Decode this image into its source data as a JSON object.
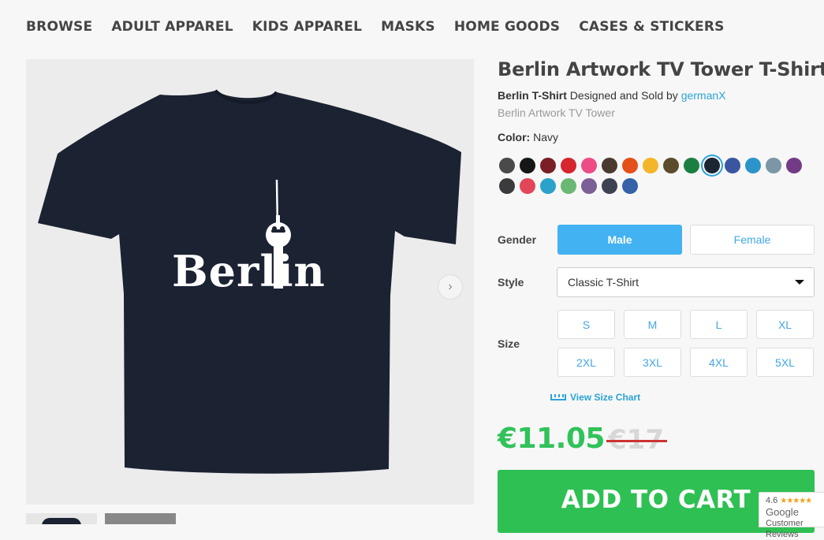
{
  "nav": [
    "BROWSE",
    "ADULT APPAREL",
    "KIDS APPAREL",
    "MASKS",
    "HOME GOODS",
    "CASES & STICKERS"
  ],
  "product": {
    "title": "Berlin Artwork TV Tower T-Shirt",
    "type_label": "Berlin T-Shirt",
    "designed_by_text": "Designed and Sold by",
    "designer": "germanX",
    "description": "Berlin Artwork TV Tower",
    "artwork_text": "Berlin"
  },
  "color": {
    "label": "Color:",
    "value": "Navy",
    "swatches": [
      "#4a4a4a",
      "#161616",
      "#7a1f24",
      "#d6262e",
      "#ee4c87",
      "#4b3a30",
      "#e4501a",
      "#f5b52a",
      "#5b4d2c",
      "#1c7f42",
      "#1d2533",
      "#3b56a0",
      "#2b94cb",
      "#7b96a4",
      "#733b86",
      "#3b3b3e",
      "#e24658",
      "#2aa2c9",
      "#6bb874",
      "#7d5f97",
      "#3e4352",
      "#3562a9"
    ],
    "selected_index": 10
  },
  "gender": {
    "label": "Gender",
    "options": [
      "Male",
      "Female"
    ],
    "selected": "Male"
  },
  "style": {
    "label": "Style",
    "value": "Classic T-Shirt"
  },
  "size": {
    "label": "Size",
    "options": [
      "S",
      "M",
      "L",
      "XL",
      "2XL",
      "3XL",
      "4XL",
      "5XL"
    ]
  },
  "size_chart_link": "View Size Chart",
  "price": {
    "current": "€11.05",
    "original": "€17"
  },
  "add_to_cart": "ADD TO CART",
  "google_badge": {
    "rating": "4.6",
    "stars": "★★★★★",
    "name": "Google",
    "sub": "Customer Reviews"
  }
}
